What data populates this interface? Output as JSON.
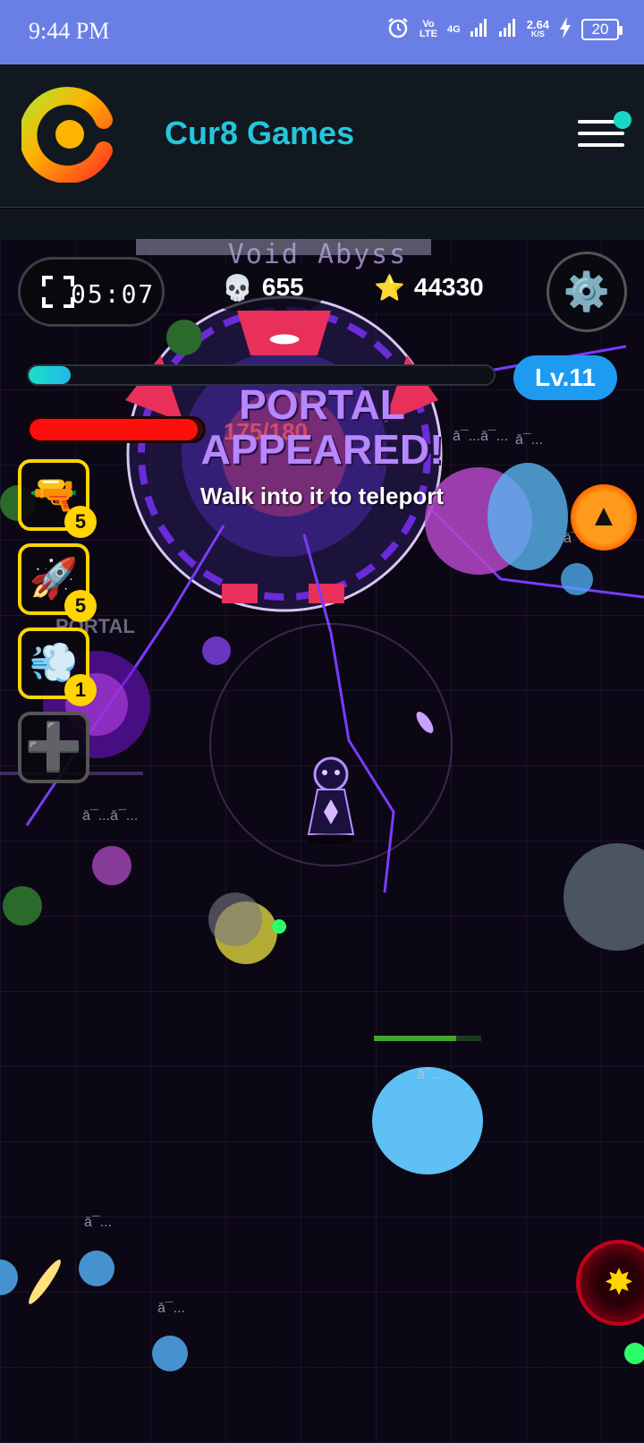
{
  "status_bar": {
    "time": "9:44 PM",
    "volte": "Vo LTE",
    "network": "4G",
    "speed_value": "2.64",
    "speed_unit": "K/S",
    "battery": "20"
  },
  "header": {
    "brand": "Cur8 Games",
    "logo_icon": "cur8-logo",
    "menu_icon": "hamburger-menu-icon",
    "accent_color": "#24c6dc"
  },
  "hud": {
    "timer": "05:07",
    "level_name": "Void Abyss",
    "kills_icon": "💀",
    "kills": "655",
    "stars_icon": "⭐",
    "stars": "44330",
    "settings_icon": "⚙️",
    "level": "Lv.11",
    "xp_fraction": 0.09,
    "hp_text": "175/180",
    "hp_fraction": 0.97
  },
  "announcement": {
    "title": "PORTAL APPEARED!",
    "subtitle": "Walk into it to teleport"
  },
  "weapons": [
    {
      "icon": "🔫",
      "name": "blaster",
      "count": "5"
    },
    {
      "icon": "🚀",
      "name": "rocket",
      "count": "5"
    },
    {
      "icon": "💨",
      "name": "smoke",
      "count": "1"
    },
    {
      "icon": "➕",
      "name": "add-slot"
    }
  ],
  "world": {
    "portal_label": "PORTAL",
    "garbled_labels": [
      "ā¯...ā¯...",
      "ā¯...",
      "ā¯...ā¯...",
      "ā¯...",
      "ā¯...",
      "ā¯...",
      "ā¯..."
    ]
  },
  "controls": {
    "up_icon": "▲",
    "skill_icon": "✸"
  }
}
